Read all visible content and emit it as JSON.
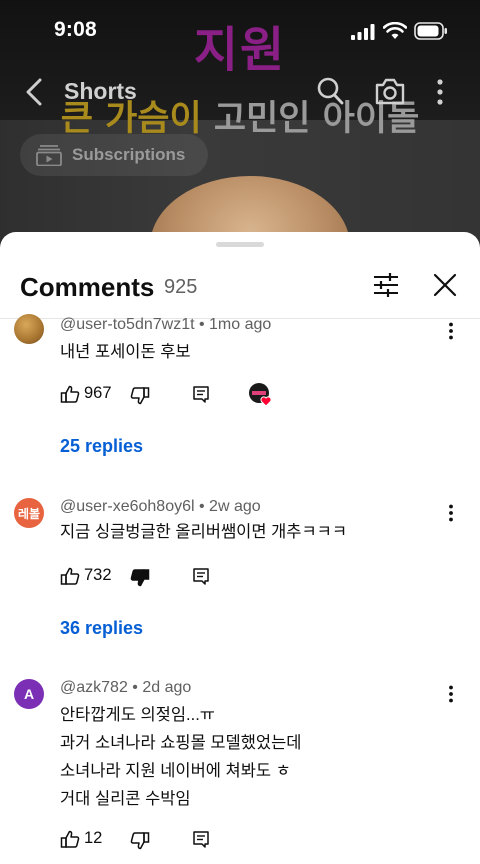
{
  "status_bar": {
    "time": "9:08"
  },
  "video": {
    "overlay_line1": "지원",
    "overlay_line2_part1": "큰 가슴이",
    "overlay_line2_part2": " 고민인 아이돌"
  },
  "top_nav": {
    "title": "Shorts"
  },
  "subscriptions_chip": {
    "label": "Subscriptions"
  },
  "comments_panel": {
    "title": "Comments",
    "count": "925",
    "comments": [
      {
        "author": "@user-to5dn7wz1t",
        "time": "1mo ago",
        "text_lines": [
          "내년 포세이돈 후보"
        ],
        "likes": "967",
        "replies_label": "25 replies",
        "creator_heart": true,
        "disliked": false,
        "avatar_color": "#b88a3a"
      },
      {
        "author": "@user-xe6oh8oy6l",
        "time": "2w ago",
        "text_lines": [
          "지금 싱글벙글한 올리버쌤이면 개추ㅋㅋㅋ"
        ],
        "likes": "732",
        "replies_label": "36 replies",
        "creator_heart": false,
        "disliked": true,
        "avatar_text": "레볼",
        "avatar_color": "#e8633f"
      },
      {
        "author": "@azk782",
        "time": "2d ago",
        "text_lines": [
          "안타깝게도 의젖임...ㅠ",
          "과거 소녀나라 쇼핑몰 모델했었는데",
          "소녀나라 지원 네이버에 쳐봐도 ㅎ",
          "거대 실리콘 수박임"
        ],
        "likes": "12",
        "creator_heart": false,
        "disliked": false,
        "avatar_text": "A",
        "avatar_color": "#7b2fb5"
      }
    ]
  },
  "colors": {
    "link_blue": "#065fd4",
    "overlay_purple": "#8a1f86",
    "overlay_gold": "#a98a1c"
  }
}
